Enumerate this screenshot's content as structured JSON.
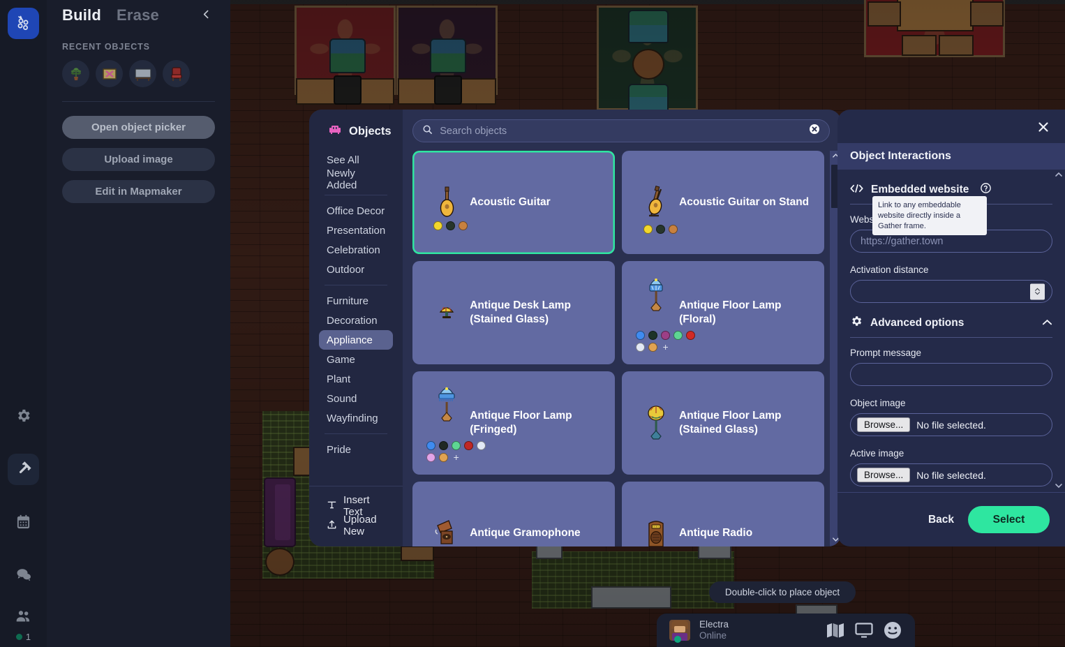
{
  "rail": {
    "logo": "gather-logo-icon",
    "items": [
      {
        "name": "settings",
        "icon": "gear-icon",
        "active": false
      },
      {
        "name": "build",
        "icon": "hammer-icon",
        "active": true
      },
      {
        "name": "calendar",
        "icon": "calendar-icon",
        "active": false
      },
      {
        "name": "chat",
        "icon": "chat-bubbles-icon",
        "active": false
      },
      {
        "name": "participants",
        "icon": "people-icon",
        "active": false
      }
    ],
    "participant_count": "1"
  },
  "build_panel": {
    "tab_build": "Build",
    "tab_erase": "Erase",
    "collapse_icon": "chevron-left-icon",
    "recent_objects_label": "RECENT OBJECTS",
    "recent_objects": [
      {
        "name": "potted-plant"
      },
      {
        "name": "framed-art"
      },
      {
        "name": "whiteboard"
      },
      {
        "name": "red-armchair"
      }
    ],
    "buttons": [
      {
        "label": "Open object picker",
        "name": "open-object-picker-button"
      },
      {
        "label": "Upload image",
        "name": "upload-image-button"
      },
      {
        "label": "Edit in Mapmaker",
        "name": "edit-in-mapmaker-button"
      }
    ]
  },
  "picker": {
    "title": "Objects",
    "title_icon": "sofa-icon",
    "search": {
      "placeholder": "Search objects",
      "value": "",
      "search_icon": "search-icon",
      "clear_icon": "clear-circle-icon"
    },
    "categories_top": [
      "See All",
      "Newly Added"
    ],
    "categories_mid": [
      "Office Decor",
      "Presentation",
      "Celebration",
      "Outdoor"
    ],
    "categories_main": [
      "Furniture",
      "Decoration",
      "Appliance",
      "Game",
      "Plant",
      "Sound",
      "Wayfinding"
    ],
    "categories_bottom": [
      "Pride"
    ],
    "selected_category": "Appliance",
    "actions": [
      {
        "label": "Insert Text",
        "icon": "text-icon"
      },
      {
        "label": "Upload New",
        "icon": "upload-icon"
      }
    ],
    "objects": [
      {
        "name": "Acoustic Guitar",
        "selected": true,
        "art": "acoustic-guitar",
        "swatches": [
          "#f2d72c",
          "#27352c",
          "#c8813f"
        ]
      },
      {
        "name": "Acoustic Guitar on Stand",
        "selected": false,
        "art": "acoustic-guitar-stand",
        "swatches": [
          "#f2d72c",
          "#27352c",
          "#c8813f"
        ]
      },
      {
        "name": "Antique Desk Lamp (Stained Glass)",
        "selected": false,
        "art": "desk-lamp-stained",
        "swatches": []
      },
      {
        "name": "Antique Floor Lamp (Floral)",
        "selected": false,
        "art": "floor-lamp-floral",
        "swatches": [
          "#3f8bf0",
          "#1d3327",
          "#9c3f86",
          "#5ed693",
          "#d22a26",
          "#e3e9f5",
          "#e0a251",
          "+"
        ]
      },
      {
        "name": "Antique Floor Lamp (Fringed)",
        "selected": false,
        "art": "floor-lamp-fringed",
        "swatches": [
          "#3f8bf0",
          "#202825",
          "#5ed693",
          "#c02724",
          "#e3e9f5",
          "#e2a4e8",
          "#e0a251",
          "+"
        ]
      },
      {
        "name": "Antique Floor Lamp (Stained Glass)",
        "selected": false,
        "art": "floor-lamp-stained",
        "swatches": []
      },
      {
        "name": "Antique Gramophone",
        "selected": false,
        "art": "gramophone",
        "swatches": []
      },
      {
        "name": "Antique Radio",
        "selected": false,
        "art": "radio",
        "swatches": []
      }
    ]
  },
  "settings": {
    "close_icon": "close-icon",
    "title": "Object Interactions",
    "embedded": {
      "icon": "code-brackets-icon",
      "label": "Embedded website",
      "help_icon": "question-circle-icon",
      "tooltip": "Link to any embeddable website directly inside a Gather frame."
    },
    "website": {
      "label": "Website (URL)*",
      "placeholder": "https://gather.town",
      "value": ""
    },
    "activation_distance": {
      "label": "Activation distance",
      "value": "",
      "spinner_icon": "number-stepper-icon"
    },
    "advanced": {
      "icon": "gear-icon",
      "label": "Advanced options",
      "chevron_icon": "chevron-up-icon"
    },
    "prompt_message": {
      "label": "Prompt message",
      "value": ""
    },
    "object_image": {
      "label": "Object image",
      "browse": "Browse...",
      "status": "No file selected."
    },
    "active_image": {
      "label": "Active image",
      "browse": "Browse...",
      "status": "No file selected."
    },
    "footer": {
      "back": "Back",
      "select": "Select"
    }
  },
  "hud": {
    "hint": "Double-click to place object",
    "user_name": "Electra",
    "user_status": "Online",
    "icons": [
      {
        "name": "map-icon"
      },
      {
        "name": "screenshare-icon"
      },
      {
        "name": "emoji-icon"
      }
    ]
  },
  "colors": {
    "accent_green": "#2ee6a0",
    "picker_bg": "#2a3050",
    "card_bg": "#626aa2",
    "panel_bg": "#242a49"
  }
}
